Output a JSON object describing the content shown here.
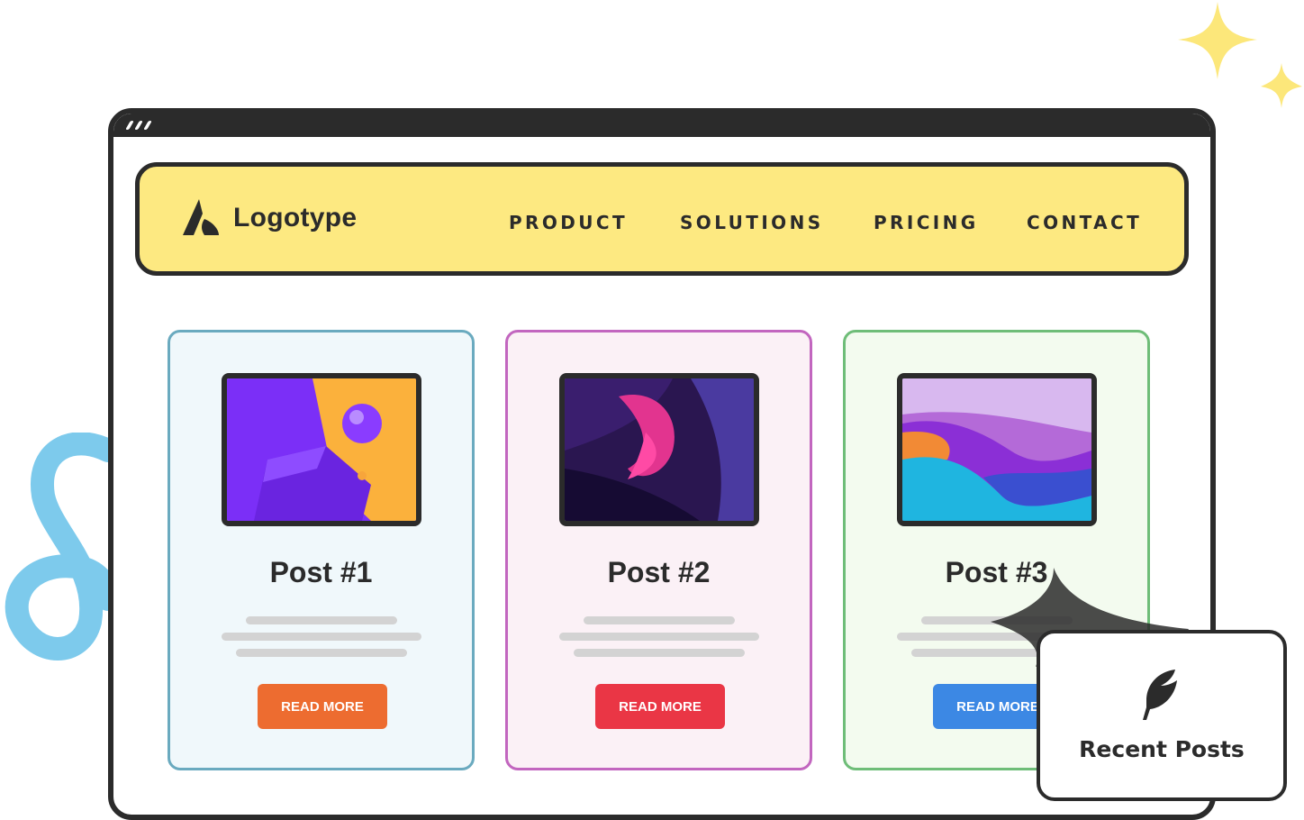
{
  "brand": {
    "name": "Logotype",
    "logo_icon": "logo-mark-icon"
  },
  "nav": {
    "items": [
      {
        "label": "PRODUCT"
      },
      {
        "label": "SOLUTIONS"
      },
      {
        "label": "PRICING"
      },
      {
        "label": "CONTACT"
      }
    ]
  },
  "posts": [
    {
      "title": "Post #1",
      "button": "READ MORE",
      "accent": "#6aaabf",
      "bg": "#f0f8fb",
      "button_color": "#ed6c30"
    },
    {
      "title": "Post #2",
      "button": "READ MORE",
      "accent": "#c266bf",
      "bg": "#fbf1f6",
      "button_color": "#ea3645"
    },
    {
      "title": "Post #3",
      "button": "READ MORE",
      "accent": "#6ebd78",
      "bg": "#f3fbef",
      "button_color": "#3c88e4"
    }
  ],
  "recent_posts": {
    "label": "Recent Posts",
    "icon": "feather-icon"
  },
  "colors": {
    "navbar_bg": "#fde981",
    "frame": "#2b2b2b",
    "sparkle": "#fce77a",
    "swirl": "#7dcaec"
  }
}
